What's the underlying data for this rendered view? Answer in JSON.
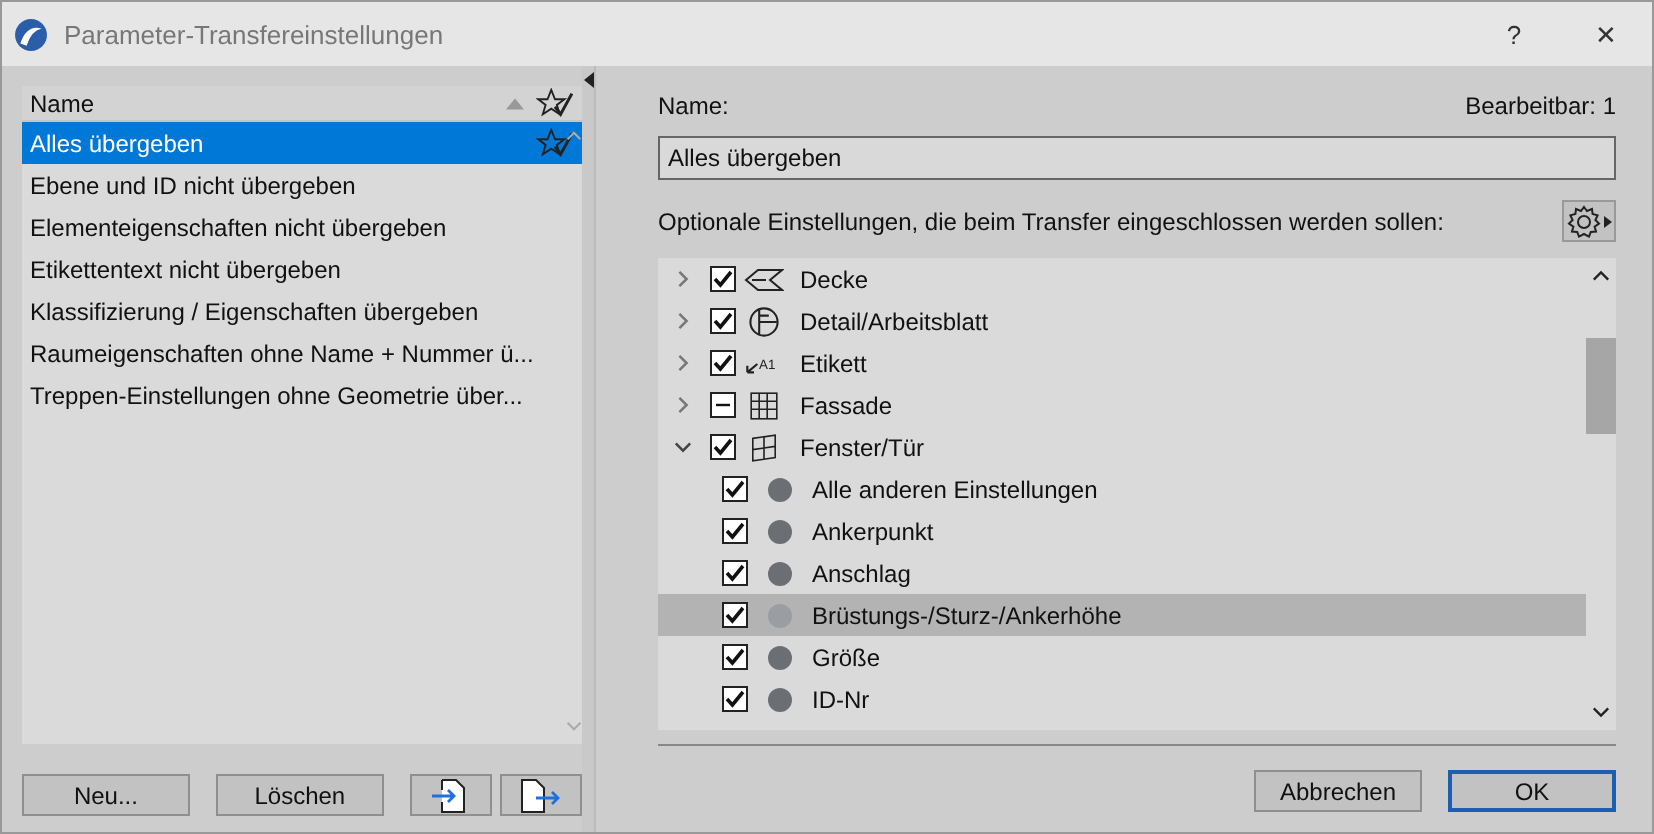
{
  "window": {
    "title": "Parameter-Transfereinstellungen",
    "help": "?",
    "close": "✕"
  },
  "list": {
    "column": "Name",
    "items": [
      {
        "label": "Alles übergeben",
        "selected": true
      },
      {
        "label": "Ebene und ID nicht übergeben",
        "selected": false
      },
      {
        "label": "Elementeigenschaften nicht übergeben",
        "selected": false
      },
      {
        "label": "Etikettentext nicht übergeben",
        "selected": false
      },
      {
        "label": "Klassifizierung / Eigenschaften übergeben",
        "selected": false
      },
      {
        "label": "Raumeigenschaften ohne Name + Nummer ü...",
        "selected": false
      },
      {
        "label": "Treppen-Einstellungen ohne Geometrie über...",
        "selected": false
      }
    ]
  },
  "left_buttons": [
    {
      "kind": "text",
      "label": "Neu..."
    },
    {
      "kind": "text",
      "label": "Löschen"
    },
    {
      "kind": "import"
    },
    {
      "kind": "export"
    }
  ],
  "name_label": "Name:",
  "editable": "Bearbeitbar: 1",
  "name_value": "Alles übergeben",
  "options_label": "Optionale Einstellungen, die beim Transfer eingeschlossen werden sollen:",
  "tree": [
    {
      "label": "Decke",
      "kind": "slab",
      "checked": true,
      "mixed": false,
      "expanded": false
    },
    {
      "label": "Detail/Arbeitsblatt",
      "kind": "detail",
      "checked": true,
      "mixed": false,
      "expanded": false
    },
    {
      "label": "Etikett",
      "kind": "label",
      "icon_text": "A1",
      "checked": true,
      "mixed": false,
      "expanded": false
    },
    {
      "label": "Fassade",
      "kind": "grid",
      "checked": false,
      "mixed": true,
      "expanded": false
    },
    {
      "label": "Fenster/Tür",
      "kind": "window",
      "checked": true,
      "mixed": false,
      "expanded": true,
      "children": [
        {
          "label": "Alle anderen Einstellungen",
          "checked": true,
          "selected": false
        },
        {
          "label": "Ankerpunkt",
          "checked": true,
          "selected": false
        },
        {
          "label": "Anschlag",
          "checked": true,
          "selected": false
        },
        {
          "label": "Brüstungs-/Sturz-/Ankerhöhe",
          "checked": true,
          "selected": true
        },
        {
          "label": "Größe",
          "checked": true,
          "selected": false
        },
        {
          "label": "ID-Nr",
          "checked": true,
          "selected": false
        }
      ]
    }
  ],
  "buttons": [
    "Abbrechen",
    "OK"
  ]
}
